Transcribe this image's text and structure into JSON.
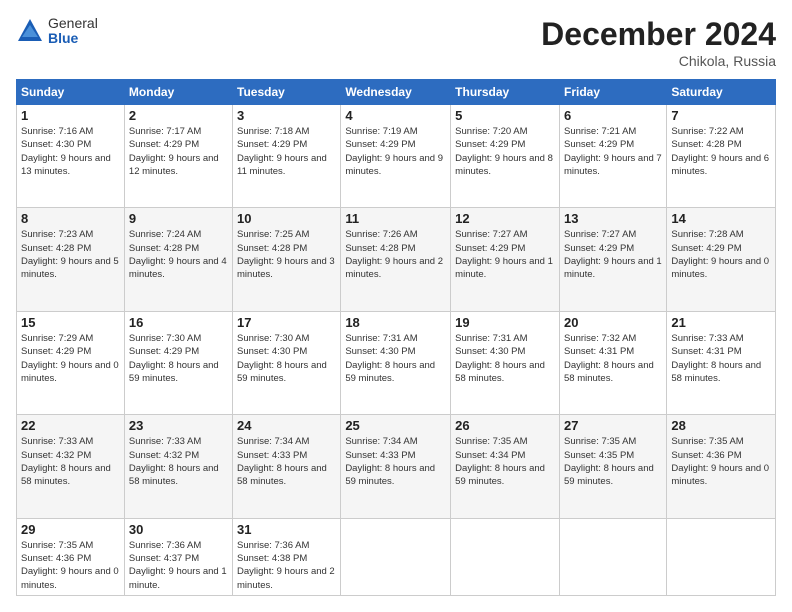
{
  "logo": {
    "general": "General",
    "blue": "Blue"
  },
  "header": {
    "title": "December 2024",
    "location": "Chikola, Russia"
  },
  "days_of_week": [
    "Sunday",
    "Monday",
    "Tuesday",
    "Wednesday",
    "Thursday",
    "Friday",
    "Saturday"
  ],
  "weeks": [
    [
      {
        "day": "1",
        "sunrise": "7:16 AM",
        "sunset": "4:30 PM",
        "daylight": "9 hours and 13 minutes."
      },
      {
        "day": "2",
        "sunrise": "7:17 AM",
        "sunset": "4:29 PM",
        "daylight": "9 hours and 12 minutes."
      },
      {
        "day": "3",
        "sunrise": "7:18 AM",
        "sunset": "4:29 PM",
        "daylight": "9 hours and 11 minutes."
      },
      {
        "day": "4",
        "sunrise": "7:19 AM",
        "sunset": "4:29 PM",
        "daylight": "9 hours and 9 minutes."
      },
      {
        "day": "5",
        "sunrise": "7:20 AM",
        "sunset": "4:29 PM",
        "daylight": "9 hours and 8 minutes."
      },
      {
        "day": "6",
        "sunrise": "7:21 AM",
        "sunset": "4:29 PM",
        "daylight": "9 hours and 7 minutes."
      },
      {
        "day": "7",
        "sunrise": "7:22 AM",
        "sunset": "4:28 PM",
        "daylight": "9 hours and 6 minutes."
      }
    ],
    [
      {
        "day": "8",
        "sunrise": "7:23 AM",
        "sunset": "4:28 PM",
        "daylight": "9 hours and 5 minutes."
      },
      {
        "day": "9",
        "sunrise": "7:24 AM",
        "sunset": "4:28 PM",
        "daylight": "9 hours and 4 minutes."
      },
      {
        "day": "10",
        "sunrise": "7:25 AM",
        "sunset": "4:28 PM",
        "daylight": "9 hours and 3 minutes."
      },
      {
        "day": "11",
        "sunrise": "7:26 AM",
        "sunset": "4:28 PM",
        "daylight": "9 hours and 2 minutes."
      },
      {
        "day": "12",
        "sunrise": "7:27 AM",
        "sunset": "4:29 PM",
        "daylight": "9 hours and 1 minute."
      },
      {
        "day": "13",
        "sunrise": "7:27 AM",
        "sunset": "4:29 PM",
        "daylight": "9 hours and 1 minute."
      },
      {
        "day": "14",
        "sunrise": "7:28 AM",
        "sunset": "4:29 PM",
        "daylight": "9 hours and 0 minutes."
      }
    ],
    [
      {
        "day": "15",
        "sunrise": "7:29 AM",
        "sunset": "4:29 PM",
        "daylight": "9 hours and 0 minutes."
      },
      {
        "day": "16",
        "sunrise": "7:30 AM",
        "sunset": "4:29 PM",
        "daylight": "8 hours and 59 minutes."
      },
      {
        "day": "17",
        "sunrise": "7:30 AM",
        "sunset": "4:30 PM",
        "daylight": "8 hours and 59 minutes."
      },
      {
        "day": "18",
        "sunrise": "7:31 AM",
        "sunset": "4:30 PM",
        "daylight": "8 hours and 59 minutes."
      },
      {
        "day": "19",
        "sunrise": "7:31 AM",
        "sunset": "4:30 PM",
        "daylight": "8 hours and 58 minutes."
      },
      {
        "day": "20",
        "sunrise": "7:32 AM",
        "sunset": "4:31 PM",
        "daylight": "8 hours and 58 minutes."
      },
      {
        "day": "21",
        "sunrise": "7:33 AM",
        "sunset": "4:31 PM",
        "daylight": "8 hours and 58 minutes."
      }
    ],
    [
      {
        "day": "22",
        "sunrise": "7:33 AM",
        "sunset": "4:32 PM",
        "daylight": "8 hours and 58 minutes."
      },
      {
        "day": "23",
        "sunrise": "7:33 AM",
        "sunset": "4:32 PM",
        "daylight": "8 hours and 58 minutes."
      },
      {
        "day": "24",
        "sunrise": "7:34 AM",
        "sunset": "4:33 PM",
        "daylight": "8 hours and 58 minutes."
      },
      {
        "day": "25",
        "sunrise": "7:34 AM",
        "sunset": "4:33 PM",
        "daylight": "8 hours and 59 minutes."
      },
      {
        "day": "26",
        "sunrise": "7:35 AM",
        "sunset": "4:34 PM",
        "daylight": "8 hours and 59 minutes."
      },
      {
        "day": "27",
        "sunrise": "7:35 AM",
        "sunset": "4:35 PM",
        "daylight": "8 hours and 59 minutes."
      },
      {
        "day": "28",
        "sunrise": "7:35 AM",
        "sunset": "4:36 PM",
        "daylight": "9 hours and 0 minutes."
      }
    ],
    [
      {
        "day": "29",
        "sunrise": "7:35 AM",
        "sunset": "4:36 PM",
        "daylight": "9 hours and 0 minutes."
      },
      {
        "day": "30",
        "sunrise": "7:36 AM",
        "sunset": "4:37 PM",
        "daylight": "9 hours and 1 minute."
      },
      {
        "day": "31",
        "sunrise": "7:36 AM",
        "sunset": "4:38 PM",
        "daylight": "9 hours and 2 minutes."
      },
      null,
      null,
      null,
      null
    ]
  ]
}
